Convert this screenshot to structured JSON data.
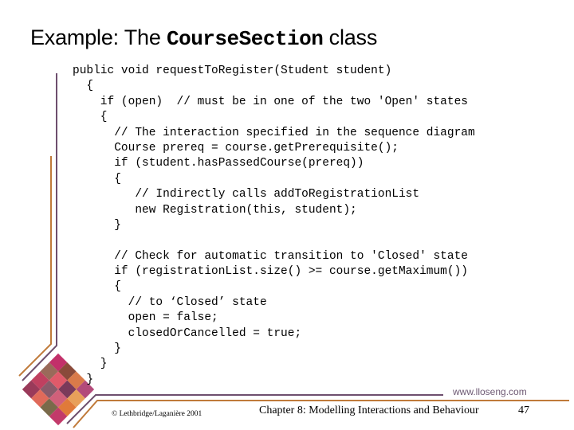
{
  "slide": {
    "title_prefix": "Example: The ",
    "title_code": "CourseSection",
    "title_suffix": " class",
    "code_lines": [
      "public void requestToRegister(Student student)",
      "  {",
      "    if (open)  // must be in one of the two 'Open' states",
      "    {",
      "      // The interaction specified in the sequence diagram",
      "      Course prereq = course.getPrerequisite();",
      "      if (student.hasPassedCourse(prereq))",
      "      {",
      "         // Indirectly calls addToRegistrationList",
      "         new Registration(this, student);",
      "      }",
      "",
      "      // Check for automatic transition to 'Closed' state",
      "      if (registrationList.size() >= course.getMaximum())",
      "      {",
      "        // to ‘Closed’ state",
      "        open = false;",
      "        closedOrCancelled = true;",
      "      }",
      "    }",
      "  }"
    ]
  },
  "footer": {
    "copyright": "© Lethbridge/Laganière 2001",
    "chapter": "Chapter 8: Modelling Interactions and Behaviour",
    "page_number": "47",
    "url": "www.lloseng.com"
  },
  "colors": {
    "purple_line": "#6e4f6e",
    "orange_line": "#c07a3a"
  }
}
